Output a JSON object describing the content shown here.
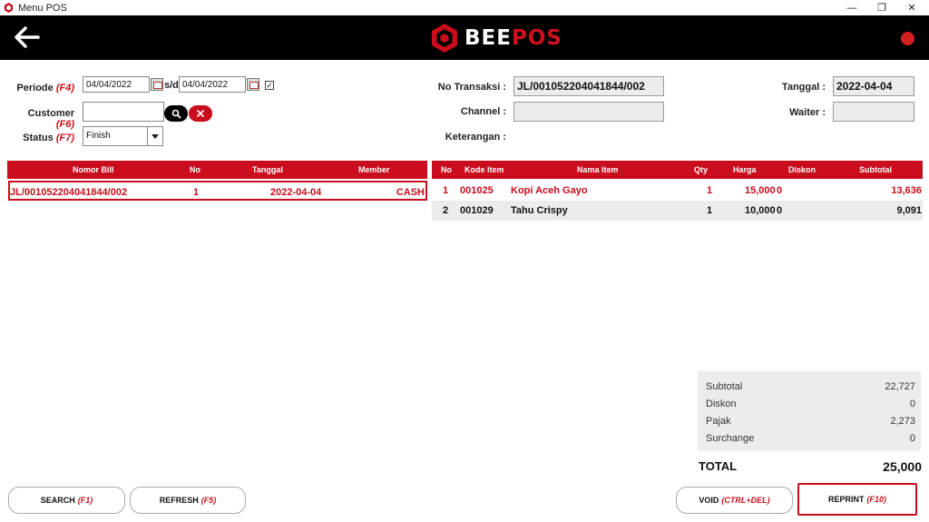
{
  "window": {
    "title": "Menu POS",
    "minimize": "—",
    "maximize": "❐",
    "close": "✕"
  },
  "brand": {
    "name_a": "BEE",
    "name_b": "POS",
    "accent": "#c90d1c"
  },
  "filters": {
    "periode_label": "Periode",
    "periode_key": "(F4)",
    "date_from": "04/04/2022",
    "sd_label": "s/d",
    "date_to": "04/04/2022",
    "checked": "✓",
    "customer_label": "Customer",
    "customer_key": "(F6)",
    "customer_value": "",
    "status_label": "Status",
    "status_key": "(F7)",
    "status_value": "Finish"
  },
  "transaction": {
    "no_label": "No Transaksi :",
    "no_value": "JL/001052204041844/002",
    "channel_label": "Channel :",
    "channel_value": "",
    "keterangan_label": "Keterangan :",
    "tanggal_label": "Tanggal :",
    "tanggal_value": "2022-04-04",
    "waiter_label": "Waiter :",
    "waiter_value": ""
  },
  "bills": {
    "headers": [
      "Nomor Bill",
      "No",
      "Tanggal",
      "Member"
    ],
    "rows": [
      {
        "bill": "JL/001052204041844/002",
        "no": "1",
        "tanggal": "2022-04-04",
        "member": "CASH"
      }
    ]
  },
  "items": {
    "headers": [
      "No",
      "Kode Item",
      "Nama Item",
      "Qty",
      "Harga",
      "Diskon",
      "Subtotal"
    ],
    "rows": [
      {
        "no": "1",
        "kode": "001025",
        "nama": "Kopi Aceh Gayo",
        "qty": "1",
        "harga": "15,000",
        "diskon": "0",
        "subtotal": "13,636"
      },
      {
        "no": "2",
        "kode": "001029",
        "nama": "Tahu Crispy",
        "qty": "1",
        "harga": "10,000",
        "diskon": "0",
        "subtotal": "9,091"
      }
    ]
  },
  "summary": {
    "subtotal_label": "Subtotal",
    "subtotal": "22,727",
    "diskon_label": "Diskon",
    "diskon": "0",
    "pajak_label": "Pajak",
    "pajak": "2,273",
    "surcharge_label": "Surchange",
    "surcharge": "0",
    "total_label": "TOTAL",
    "total": "25,000"
  },
  "buttons": {
    "search": "SEARCH",
    "search_key": "(F1)",
    "refresh": "REFRESH",
    "refresh_key": "(F5)",
    "void": "VOID",
    "void_key": "(CTRL+DEL)",
    "reprint": "REPRINT",
    "reprint_key": "(F10)"
  },
  "icons": [
    "back-arrow-icon",
    "beepos-logo-icon",
    "calendar-icon",
    "search-icon",
    "clear-icon",
    "chevron-down-icon"
  ]
}
